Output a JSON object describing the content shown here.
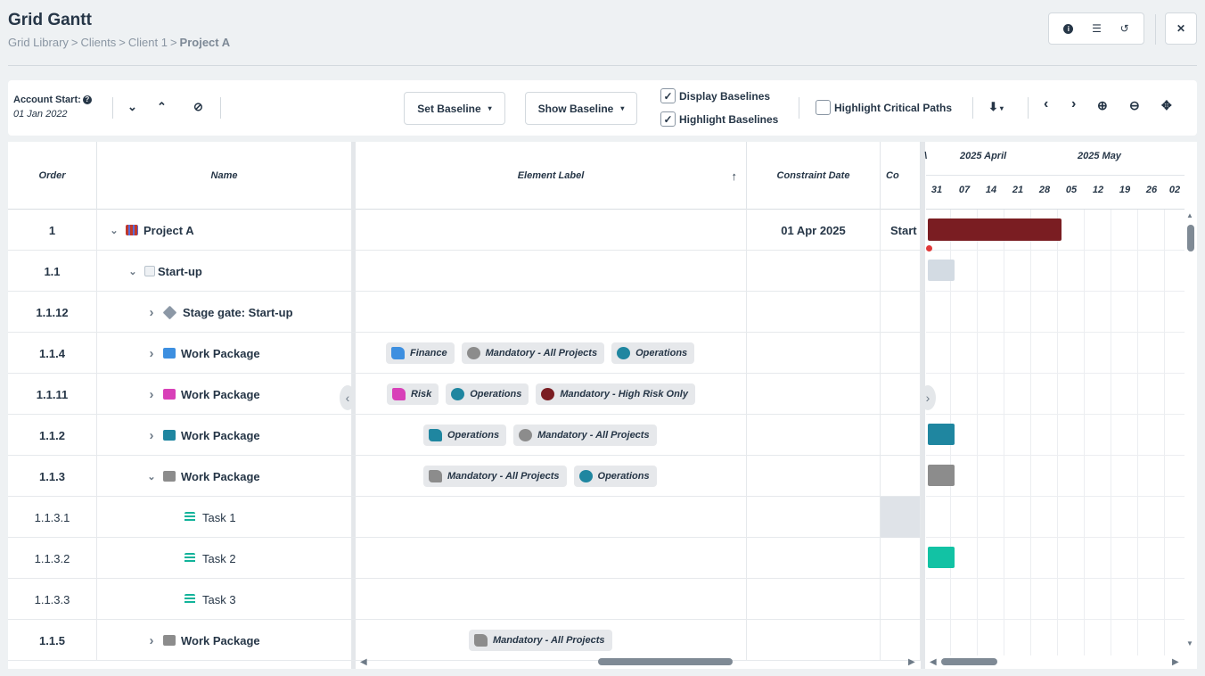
{
  "header": {
    "title": "Grid Gantt",
    "breadcrumb": [
      "Grid Library",
      "Clients",
      "Client 1",
      "Project A"
    ],
    "info_icon": "i",
    "list_icon": "☰",
    "reset_icon": "↺",
    "close_icon": "✕"
  },
  "toolbar": {
    "account_start_label": "Account Start:",
    "account_start_help": "?",
    "account_start_value": "01 Jan 2022",
    "expand_all_icon": "⌄",
    "collapse_all_icon": "⌃",
    "clear_filter_icon": "⊘",
    "set_baseline": "Set Baseline",
    "show_baseline": "Show Baseline",
    "display_baselines": "Display Baselines",
    "display_baselines_checked": "✓",
    "highlight_baselines": "Highlight Baselines",
    "highlight_baselines_checked": "✓",
    "highlight_critical_paths": "Highlight Critical Paths",
    "download_icon": "⬇",
    "prev_icon": "‹",
    "next_icon": "›",
    "zoom_in_icon": "⊕",
    "zoom_out_icon": "⊖",
    "fit_icon": "✥",
    "caret": "▾"
  },
  "columns": {
    "order": "Order",
    "name": "Name",
    "element_label": "Element Label",
    "sort_icon": "↑",
    "constraint_date": "Constraint Date",
    "constraint_type_partial": "Co"
  },
  "rows": [
    {
      "order": "1",
      "chev": "⌄",
      "name": "Project A",
      "constraint_date": "01 Apr 2025",
      "constraint_type": "Start",
      "tags": []
    },
    {
      "order": "1.1",
      "chev": "⌄",
      "name": "Start-up",
      "constraint_date": "",
      "constraint_type": "",
      "tags": []
    },
    {
      "order": "1.1.12",
      "chev": "›",
      "name": "Stage gate: Start-up",
      "constraint_date": "",
      "constraint_type": "",
      "tags": []
    },
    {
      "order": "1.1.4",
      "chev": "›",
      "name": "Work Package",
      "constraint_date": "",
      "constraint_type": "",
      "tags": [
        {
          "label": "Finance",
          "color": "#3d8fe0"
        },
        {
          "label": "Mandatory - All Projects",
          "color": "#8c8c8c"
        },
        {
          "label": "Operations",
          "color": "#1f86a0"
        }
      ]
    },
    {
      "order": "1.1.11",
      "chev": "›",
      "name": "Work Package",
      "constraint_date": "",
      "constraint_type": "",
      "tags": [
        {
          "label": "Risk",
          "color": "#d840b8"
        },
        {
          "label": "Operations",
          "color": "#1f86a0"
        },
        {
          "label": "Mandatory - High Risk Only",
          "color": "#7a1d22"
        }
      ]
    },
    {
      "order": "1.1.2",
      "chev": "›",
      "name": "Work Package",
      "constraint_date": "",
      "constraint_type": "",
      "tags": [
        {
          "label": "Operations",
          "color": "#1f86a0"
        },
        {
          "label": "Mandatory - All Projects",
          "color": "#8c8c8c"
        }
      ]
    },
    {
      "order": "1.1.3",
      "chev": "⌄",
      "name": "Work Package",
      "constraint_date": "",
      "constraint_type": "",
      "tags": [
        {
          "label": "Mandatory - All Projects",
          "color": "#8c8c8c"
        },
        {
          "label": "Operations",
          "color": "#1f86a0"
        }
      ]
    },
    {
      "order": "1.1.3.1",
      "chev": "",
      "name": "Task 1",
      "constraint_date": "",
      "constraint_type": "",
      "tags": []
    },
    {
      "order": "1.1.3.2",
      "chev": "",
      "name": "Task 2",
      "constraint_date": "",
      "constraint_type": "",
      "tags": []
    },
    {
      "order": "1.1.3.3",
      "chev": "",
      "name": "Task 3",
      "constraint_date": "",
      "constraint_type": "",
      "tags": []
    },
    {
      "order": "1.1.5",
      "chev": "›",
      "name": "Work Package",
      "constraint_date": "",
      "constraint_type": "",
      "tags": [
        {
          "label": "Mandatory - All Projects",
          "color": "#8c8c8c"
        }
      ]
    }
  ],
  "gantt": {
    "months": [
      "2025 April",
      "2025 May"
    ],
    "month_partial": "\\",
    "days": [
      "31",
      "07",
      "14",
      "21",
      "28",
      "05",
      "12",
      "19",
      "26",
      "02"
    ],
    "bar_colors": {
      "project": "#7a1d22",
      "startup": "#d3dbe3",
      "wp_112": "#1f86a0",
      "wp_113": "#8c8c8c",
      "task_2": "#12c2a4",
      "milestone": "#e03838"
    }
  },
  "icons": {
    "project": "#c0392b",
    "startup": "#b9c3cc",
    "stage_gate": "#8c98a6",
    "wp_finance": "#3d8fe0",
    "wp_risk": "#d840b8",
    "wp_ops": "#1f86a0",
    "wp_mandatory": "#8c8c8c",
    "task": "#12b39a"
  },
  "nav": {
    "left": "‹",
    "right": "›"
  }
}
